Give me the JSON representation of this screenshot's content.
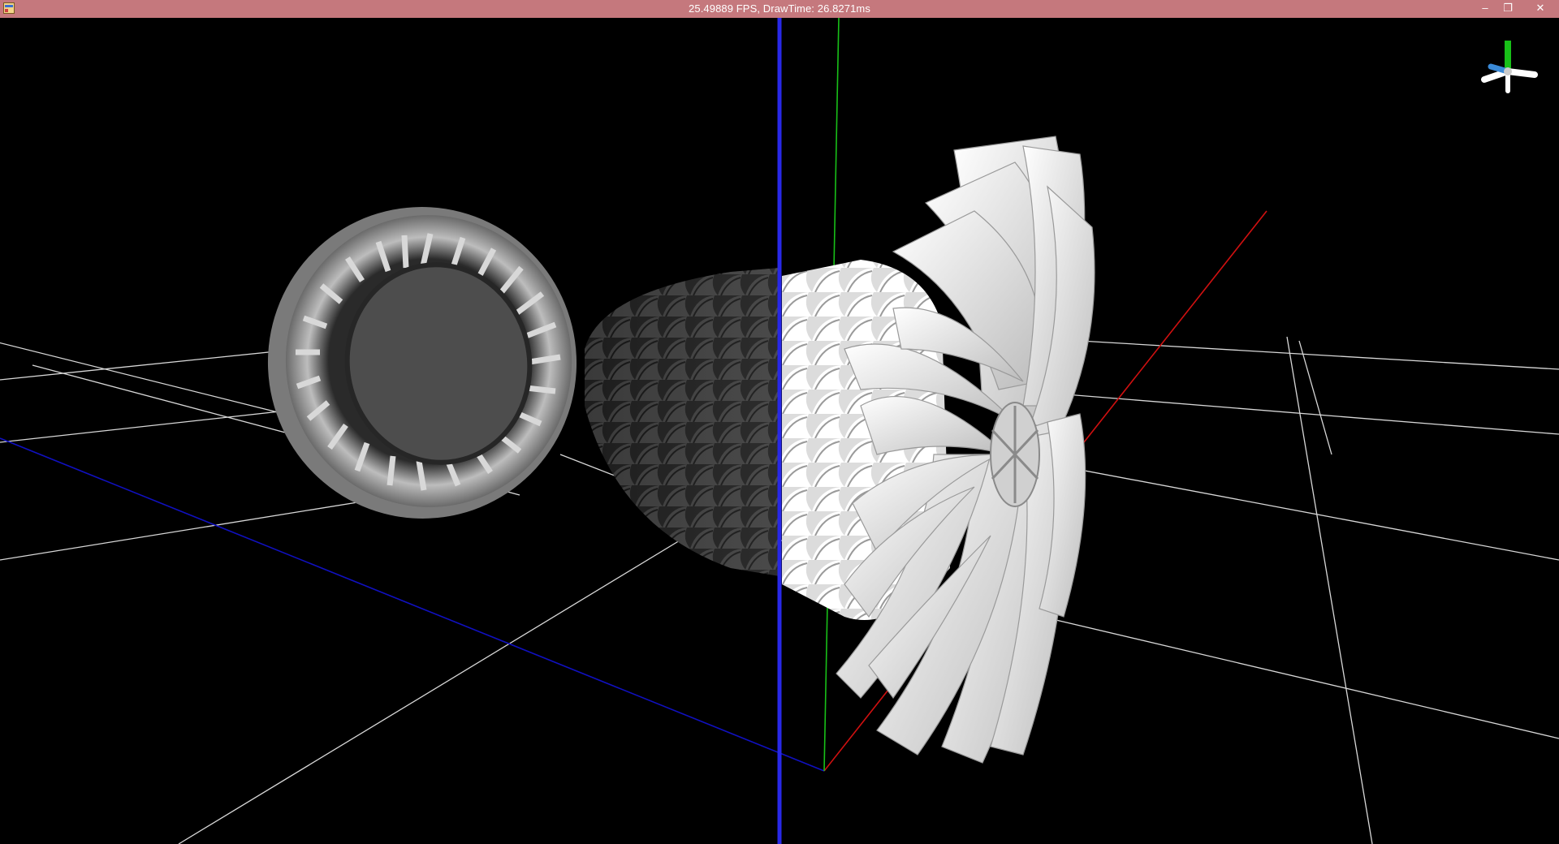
{
  "window": {
    "title": "25.49889 FPS, DrawTime: 26.8271ms",
    "minimize_glyph": "–",
    "maximize_glyph": "❐",
    "close_glyph": "✕"
  },
  "icons": {
    "app": "app-window-icon",
    "minimize": "minimize-icon",
    "maximize": "restore-icon",
    "close": "close-icon",
    "orientation": "axis-orientation-gizmo-icon"
  },
  "colors": {
    "titlebar": "#c5787d",
    "background": "#000000",
    "grid": "#d8d8d8",
    "axis_x": "#d01010",
    "axis_y": "#18c018",
    "axis_z": "#1818d8",
    "axis_z_ground": "#1010c0",
    "engine_dark": "#3a3a3a",
    "engine_light": "#f0f0f0"
  },
  "scene": {
    "model": "turbofan-engine-model",
    "grid_visible": true
  }
}
